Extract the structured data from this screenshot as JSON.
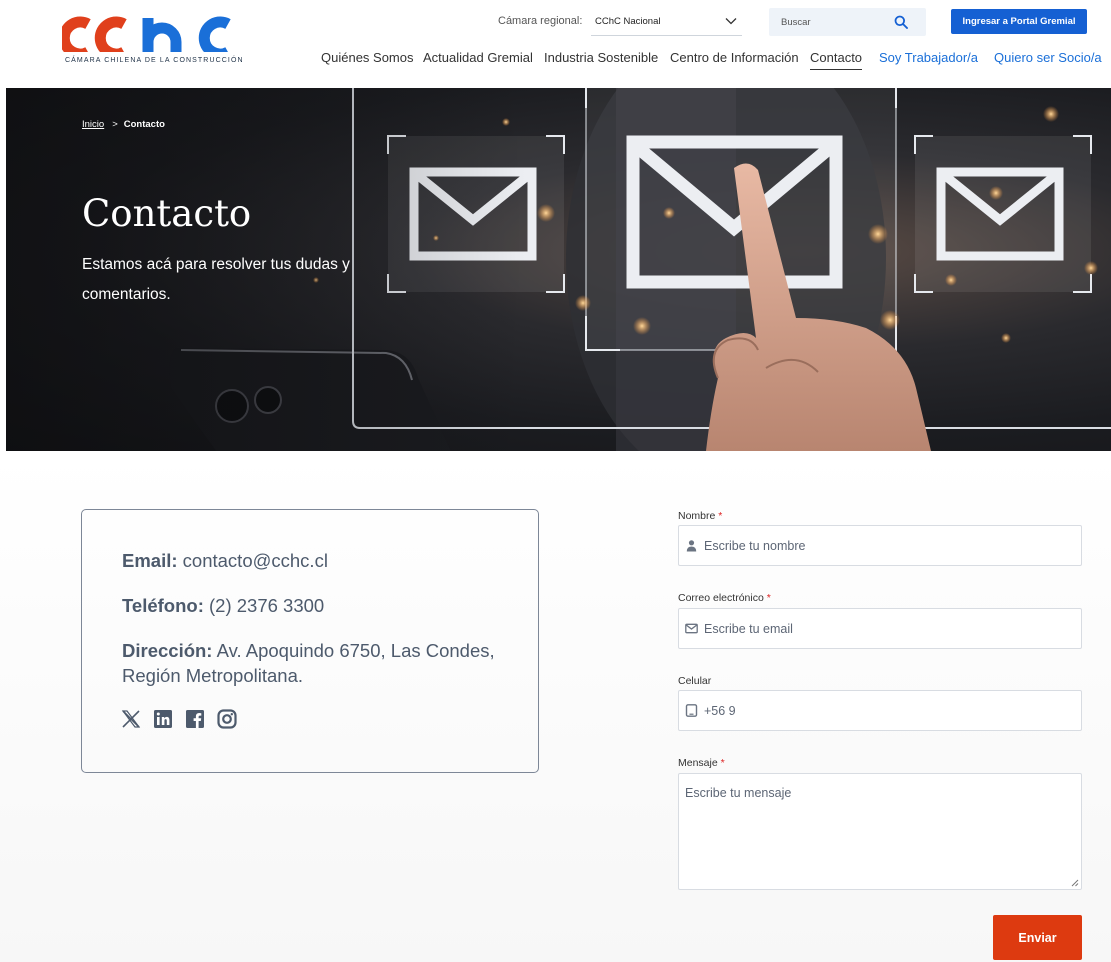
{
  "brand": {
    "caption": "CÁMARA CHILENA DE LA CONSTRUCCIÓN",
    "red": "#e0401c",
    "blue": "#1a6fd8"
  },
  "topbar": {
    "region_label": "Cámara regional:",
    "region_value": "CChC Nacional",
    "search_placeholder": "Buscar",
    "portal_button": "Ingresar a Portal Gremial"
  },
  "nav": {
    "items": [
      {
        "label": "Quiénes Somos"
      },
      {
        "label": "Actualidad Gremial"
      },
      {
        "label": "Industria Sostenible"
      },
      {
        "label": "Centro de Información"
      },
      {
        "label": "Contacto"
      },
      {
        "label": "Soy Trabajador/a"
      },
      {
        "label": "Quiero ser Socio/a"
      }
    ]
  },
  "hero": {
    "breadcrumb_home": "Inicio",
    "breadcrumb_separator": ">",
    "breadcrumb_current": "Contacto",
    "title": "Contacto",
    "subtitle": "Estamos acá para resolver tus dudas y comentarios."
  },
  "info": {
    "email_label": "Email:",
    "email_value": "contacto@cchc.cl",
    "phone_label": "Teléfono:",
    "phone_value": "(2) 2376 3300",
    "address_label": "Dirección:",
    "address_value": "Av. Apoquindo 6750, Las Condes, Región Metropolitana.",
    "socials": [
      "x-icon",
      "linkedin-icon",
      "facebook-icon",
      "instagram-icon"
    ]
  },
  "form": {
    "name_label": "Nombre",
    "name_placeholder": "Escribe tu nombre",
    "email_label": "Correo electrónico",
    "email_placeholder": "Escribe tu email",
    "phone_label": "Celular",
    "phone_placeholder": "+56 9",
    "message_label": "Mensaje",
    "message_placeholder": "Escribe tu mensaje",
    "required_mark": "*",
    "submit": "Enviar"
  }
}
